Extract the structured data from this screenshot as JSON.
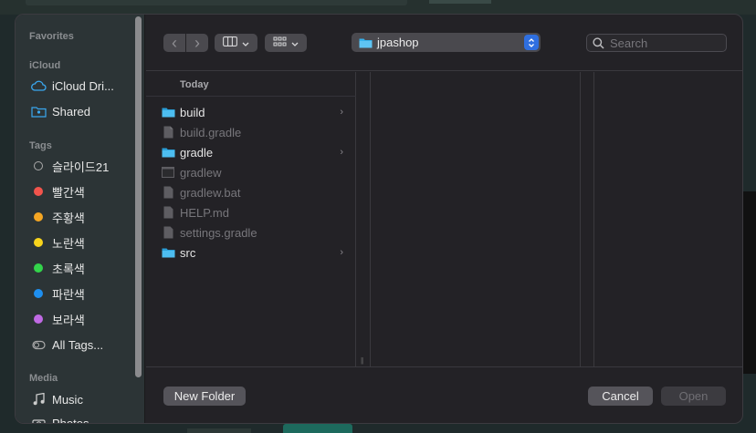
{
  "colors": {
    "folder": "#35b1ec",
    "accent": "#2f6fe0",
    "tag_red": "#f2544c",
    "tag_orange": "#f5a623",
    "tag_yellow": "#f8d41c",
    "tag_green": "#33d44b",
    "tag_blue": "#1e8ff0",
    "tag_purple": "#c06ae4"
  },
  "sidebar": {
    "sections": {
      "favorites": "Favorites",
      "icloud": "iCloud",
      "tags": "Tags",
      "media": "Media"
    },
    "icloud_items": [
      {
        "label": "iCloud Dri...",
        "icon": "cloud-icon"
      },
      {
        "label": "Shared",
        "icon": "shared-folder-icon"
      }
    ],
    "tag_items": [
      {
        "label": "슬라이드21",
        "color": "hollow"
      },
      {
        "label": "빨간색",
        "color": "#f2544c"
      },
      {
        "label": "주황색",
        "color": "#f5a623"
      },
      {
        "label": "노란색",
        "color": "#f8d41c"
      },
      {
        "label": "초록색",
        "color": "#33d44b"
      },
      {
        "label": "파란색",
        "color": "#1e8ff0"
      },
      {
        "label": "보라색",
        "color": "#c06ae4"
      },
      {
        "label": "All Tags...",
        "icon": "all-tags-icon"
      }
    ],
    "media_items": [
      {
        "label": "Music",
        "icon": "music-note-icon"
      },
      {
        "label": "Photos",
        "icon": "camera-icon"
      }
    ]
  },
  "toolbar": {
    "back": "‹",
    "forward": "›",
    "path": "jpashop",
    "search_placeholder": "Search"
  },
  "browser": {
    "section_header": "Today",
    "files": [
      {
        "name": "build",
        "type": "folder",
        "enabled": true,
        "has_children": true
      },
      {
        "name": "build.gradle",
        "type": "file",
        "enabled": false,
        "has_children": false
      },
      {
        "name": "gradle",
        "type": "folder",
        "enabled": true,
        "has_children": true
      },
      {
        "name": "gradlew",
        "type": "exec",
        "enabled": false,
        "has_children": false
      },
      {
        "name": "gradlew.bat",
        "type": "file",
        "enabled": false,
        "has_children": false
      },
      {
        "name": "HELP.md",
        "type": "file",
        "enabled": false,
        "has_children": false
      },
      {
        "name": "settings.gradle",
        "type": "file",
        "enabled": false,
        "has_children": false
      },
      {
        "name": "src",
        "type": "folder",
        "enabled": true,
        "has_children": true
      }
    ],
    "column_grip": "||"
  },
  "footer": {
    "new_folder": "New Folder",
    "cancel": "Cancel",
    "open": "Open"
  }
}
